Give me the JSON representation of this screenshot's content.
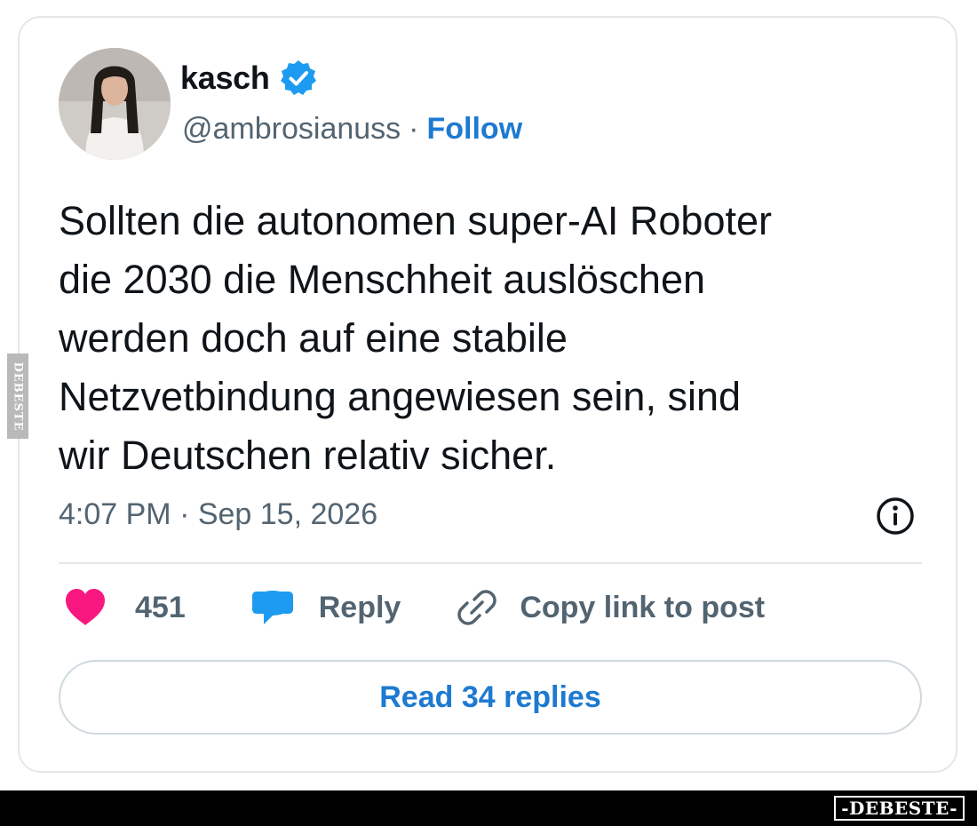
{
  "post": {
    "author_name": "kasch",
    "handle": "@ambrosianuss",
    "separator": "·",
    "follow_label": "Follow",
    "text": "Sollten die autonomen super-AI Roboter\ndie 2030 die Menschheit auslöschen\nwerden doch auf eine stabile\nNetzvetbindung angewiesen sein, sind\nwir Deutschen relativ sicher.",
    "timestamp": "4:07 PM · Sep 15, 2026"
  },
  "actions": {
    "like_count": "451",
    "reply_label": "Reply",
    "copy_label": "Copy link to post"
  },
  "read_replies_label": "Read 34 replies",
  "watermark": {
    "side": "DEBESTE",
    "logo": "-DEBESTE-"
  },
  "icons": {
    "verified": "verified-badge-icon",
    "info": "info-icon",
    "like": "heart-icon",
    "reply": "speech-bubble-icon",
    "copy": "link-icon"
  },
  "colors": {
    "accent": "#1d7ad0",
    "verified": "#1d9bf0",
    "heart": "#f91880",
    "reply_bubble": "#1d9bf0",
    "muted": "#536471",
    "text": "#0f1419"
  }
}
